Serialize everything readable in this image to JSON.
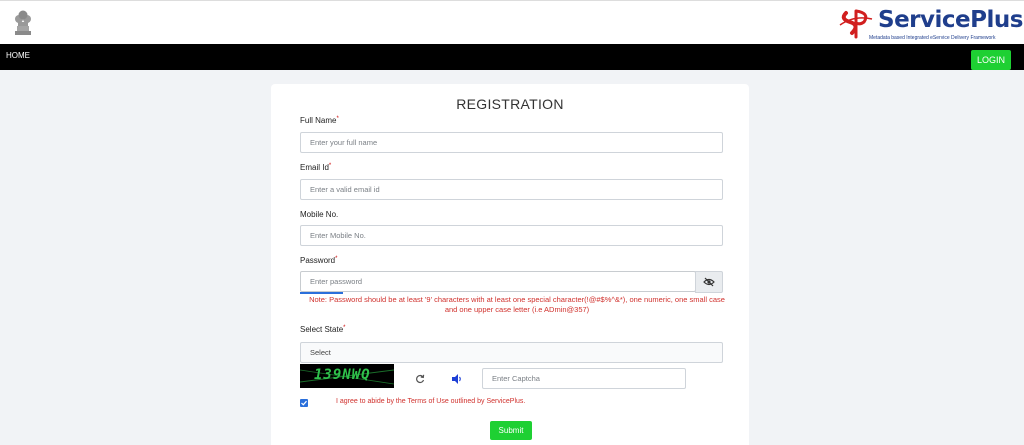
{
  "nav": {
    "home_label": "HOME",
    "login_label": "LOGIN"
  },
  "brand": {
    "name": "ServicePlus",
    "tagline": "Metadata based Integrated eService Delivery Framework"
  },
  "form": {
    "title": "REGISTRATION",
    "full_name": {
      "label": "Full Name",
      "required": "*",
      "placeholder": "Enter your full name"
    },
    "email": {
      "label": "Email Id",
      "required": "*",
      "placeholder": "Enter a valid email id"
    },
    "mobile": {
      "label": "Mobile No.",
      "placeholder": "Enter Mobile No."
    },
    "password": {
      "label": "Password",
      "required": "*",
      "placeholder": "Enter password",
      "note": "Note: Password should be at least '9' characters with at least one special character(!@#$%^&*), one numeric, one small case and one upper case letter (i.e ADmin@357)"
    },
    "state": {
      "label": "Select State",
      "required": "*",
      "selected": "Select"
    },
    "captcha": {
      "code": "139NWQ",
      "placeholder": "Enter Captcha"
    },
    "agree_text": "I agree to abide by the Terms of Use outlined by ServicePlus.",
    "agree_checked": true,
    "submit_label": "Submit"
  },
  "colors": {
    "accent_green": "#1ed033",
    "nav_black": "#000000",
    "brand_blue": "#1f3e8c",
    "error_red": "#d0312d",
    "check_blue": "#2a6fdb"
  }
}
